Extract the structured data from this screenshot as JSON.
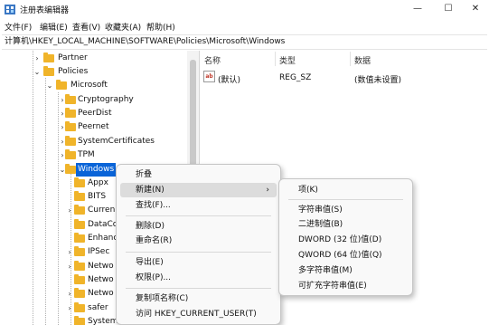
{
  "window": {
    "title": "注册表编辑器",
    "minimize_glyph": "—",
    "maximize_glyph": "☐",
    "close_glyph": "✕"
  },
  "menubar": [
    "文件(F)",
    "编辑(E)",
    "查看(V)",
    "收藏夹(A)",
    "帮助(H)"
  ],
  "address": "计算机\\HKEY_LOCAL_MACHINE\\SOFTWARE\\Policies\\Microsoft\\Windows",
  "tree": [
    {
      "label": "Partner",
      "chev": "›"
    },
    {
      "label": "Policies",
      "chev": "⌄"
    },
    {
      "label": "Microsoft",
      "chev": "⌄"
    },
    {
      "label": "Cryptography",
      "chev": "›"
    },
    {
      "label": "PeerDist",
      "chev": "›"
    },
    {
      "label": "Peernet",
      "chev": "›"
    },
    {
      "label": "SystemCertificates",
      "chev": "›"
    },
    {
      "label": "TPM",
      "chev": "›"
    },
    {
      "label": "Windows",
      "chev": "⌄"
    },
    {
      "label": "Appx",
      "chev": ""
    },
    {
      "label": "BITS",
      "chev": ""
    },
    {
      "label": "Curren",
      "chev": "›"
    },
    {
      "label": "DataCo",
      "chev": ""
    },
    {
      "label": "Enhanc",
      "chev": ""
    },
    {
      "label": "IPSec",
      "chev": "›"
    },
    {
      "label": "Netwo",
      "chev": "›"
    },
    {
      "label": "Netwo",
      "chev": ""
    },
    {
      "label": "Netwo",
      "chev": "›"
    },
    {
      "label": "safer",
      "chev": "›"
    },
    {
      "label": "System",
      "chev": ""
    }
  ],
  "list": {
    "headers": {
      "name": "名称",
      "type": "类型",
      "data": "数据"
    },
    "rows": [
      {
        "icon_text": "ab",
        "name": "(默认)",
        "type": "REG_SZ",
        "data": "(数值未设置)"
      }
    ]
  },
  "context_menu": {
    "items": [
      {
        "label": "折叠"
      },
      {
        "label": "新建(N)",
        "arrow": "›",
        "highlighted": true
      },
      {
        "label": "查找(F)..."
      },
      {
        "label": "删除(D)"
      },
      {
        "label": "重命名(R)"
      },
      {
        "label": "导出(E)"
      },
      {
        "label": "权限(P)..."
      },
      {
        "label": "复制项名称(C)"
      },
      {
        "label": "访问 HKEY_CURRENT_USER(T)"
      }
    ]
  },
  "submenu": {
    "items": [
      "项(K)",
      "字符串值(S)",
      "二进制值(B)",
      "DWORD (32 位)值(D)",
      "QWORD (64 位)值(Q)",
      "多字符串值(M)",
      "可扩充字符串值(E)"
    ]
  },
  "colors": {
    "selection": "#0a64d8",
    "folder": "#f0b42a",
    "menu_highlight": "#dcdcdc"
  }
}
